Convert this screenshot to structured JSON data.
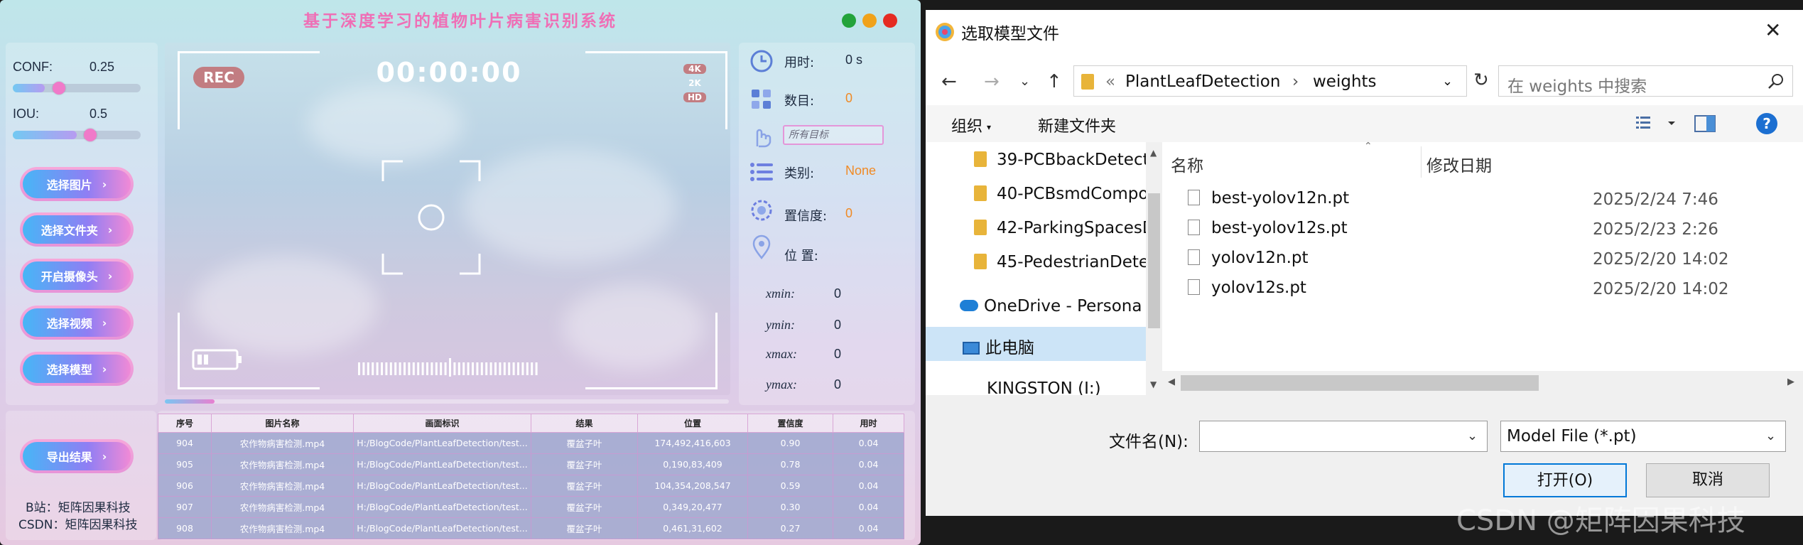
{
  "app": {
    "title": "基于深度学习的植物叶片病害识别系统",
    "window_controls": {
      "colors": [
        "#23a33b",
        "#f0a21a",
        "#e52b22"
      ]
    },
    "params": {
      "conf": {
        "label": "CONF:",
        "value": "0.25",
        "fraction": 0.25
      },
      "iou": {
        "label": "IOU:",
        "value": "0.5",
        "fraction": 0.5
      }
    },
    "buttons": {
      "select_image": "选择图片",
      "select_folder": "选择文件夹",
      "open_camera": "开启摄像头",
      "select_video": "选择视频",
      "select_model": "选择模型",
      "export": "导出结果",
      "chevron": "›"
    },
    "credits": {
      "bilibili": "B站：矩阵因果科技",
      "csdn": "CSDN：矩阵因果科技"
    },
    "camera": {
      "rec": "REC",
      "timer": "00:00:00",
      "quality": [
        "4K",
        "2K",
        "HD"
      ]
    },
    "info": {
      "time_label": "用时:",
      "time_value": "0 s",
      "count_label": "数目:",
      "count_value": "0",
      "target_select": "所有目标",
      "class_label": "类别:",
      "class_value": "None",
      "conf_label": "置信度:",
      "conf_value": "0",
      "pos_label": "位 置:",
      "coords": [
        {
          "label": "xmin:",
          "value": "0"
        },
        {
          "label": "ymin:",
          "value": "0"
        },
        {
          "label": "xmax:",
          "value": "0"
        },
        {
          "label": "ymax:",
          "value": "0"
        }
      ],
      "value_color": "#f08a24"
    },
    "table": {
      "headers": [
        "序号",
        "图片名称",
        "画面标识",
        "结果",
        "位置",
        "置信度",
        "用时"
      ],
      "rows": [
        [
          "904",
          "农作物病害检测.mp4",
          "H:/BlogCode/PlantLeafDetection/test...",
          "覆盆子叶",
          "174,492,416,603",
          "0.90",
          "0.04"
        ],
        [
          "905",
          "农作物病害检测.mp4",
          "H:/BlogCode/PlantLeafDetection/test...",
          "覆盆子叶",
          "0,190,83,409",
          "0.78",
          "0.04"
        ],
        [
          "906",
          "农作物病害检测.mp4",
          "H:/BlogCode/PlantLeafDetection/test...",
          "覆盆子叶",
          "104,354,208,547",
          "0.59",
          "0.04"
        ],
        [
          "907",
          "农作物病害检测.mp4",
          "H:/BlogCode/PlantLeafDetection/test...",
          "覆盆子叶",
          "0,349,20,477",
          "0.30",
          "0.04"
        ],
        [
          "908",
          "农作物病害检测.mp4",
          "H:/BlogCode/PlantLeafDetection/test...",
          "覆盆子叶",
          "0,461,31,602",
          "0.27",
          "0.04"
        ]
      ]
    }
  },
  "dialog": {
    "title": "选取模型文件",
    "close": "✕",
    "nav": {
      "back": "←",
      "forward": "→",
      "dropdown": "⌄",
      "up": "↑",
      "refresh": "↻"
    },
    "address": {
      "prefix": "«",
      "path": [
        "PlantLeafDetection",
        "weights"
      ],
      "sep": "›"
    },
    "search_placeholder": "在 weights 中搜索",
    "toolbar": {
      "organize": "组织",
      "new_folder": "新建文件夹"
    },
    "nav_pane": [
      "39-PCBbackDetect",
      "40-PCBsmdCompo",
      "42-ParkingSpacesD",
      "45-PedestrianDete",
      "OneDrive - Persona",
      "此电脑",
      "KINGSTON (I:)"
    ],
    "columns": {
      "name": "名称",
      "date": "修改日期"
    },
    "files": [
      {
        "name": "best-yolov12n.pt",
        "date": "2025/2/24 7:46"
      },
      {
        "name": "best-yolov12s.pt",
        "date": "2025/2/23 2:26"
      },
      {
        "name": "yolov12n.pt",
        "date": "2025/2/20 14:02"
      },
      {
        "name": "yolov12s.pt",
        "date": "2025/2/20 14:02"
      }
    ],
    "filename_label": "文件名(N):",
    "filename_value": "",
    "filetype": "Model File (*.pt)",
    "open_btn": "打开(O)",
    "cancel_btn": "取消"
  },
  "watermark": "CSDN @矩阵因果科技"
}
